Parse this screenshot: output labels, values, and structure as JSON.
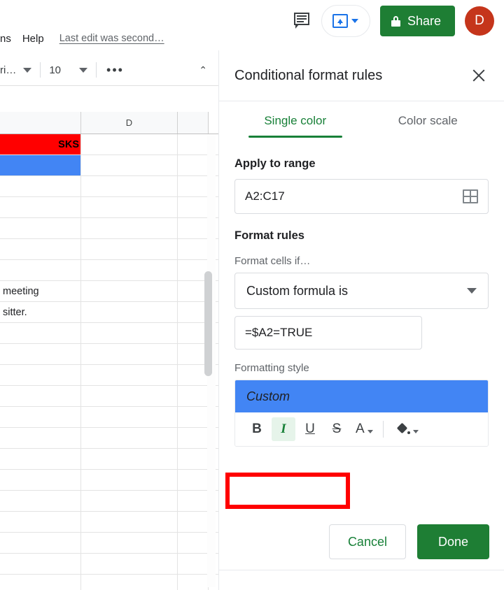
{
  "menubar": {
    "items": [
      {
        "label": "ns",
        "name": "menu-item-extensions-clipped"
      },
      {
        "label": "Help",
        "name": "menu-item-help"
      }
    ],
    "last_edit": "Last edit was second…"
  },
  "toolbar": {
    "font_name": "ri…",
    "font_size": "10",
    "more_label": "•••",
    "collapse_label": "⌃"
  },
  "header": {
    "comment_icon": "comment-icon",
    "present_icon": "present-icon",
    "share_label": "Share",
    "share_lock_icon": "lock-icon",
    "avatar_initial": "D",
    "avatar_color": "#C5351B",
    "share_color": "#1E7E34"
  },
  "sheet": {
    "columns": [
      "",
      "D",
      ""
    ],
    "rows": [
      {
        "a": "SKS",
        "fill": "#FF0000",
        "d": "",
        "e": ""
      },
      {
        "a": "",
        "fill": "#4285F4",
        "d": "",
        "e": ""
      },
      {
        "a": "",
        "fill": "",
        "d": "",
        "e": ""
      },
      {
        "a": "",
        "fill": "",
        "d": "",
        "e": ""
      },
      {
        "a": "",
        "fill": "",
        "d": "",
        "e": ""
      },
      {
        "a": "",
        "fill": "",
        "d": "",
        "e": ""
      },
      {
        "a": "",
        "fill": "",
        "d": "",
        "e": ""
      },
      {
        "a": "meeting",
        "fill": "",
        "d": "",
        "e": ""
      },
      {
        "a": "sitter.",
        "fill": "",
        "d": "",
        "e": ""
      },
      {
        "a": "",
        "fill": "",
        "d": "",
        "e": ""
      },
      {
        "a": "",
        "fill": "",
        "d": "",
        "e": ""
      },
      {
        "a": "",
        "fill": "",
        "d": "",
        "e": ""
      },
      {
        "a": "",
        "fill": "",
        "d": "",
        "e": ""
      },
      {
        "a": "",
        "fill": "",
        "d": "",
        "e": ""
      },
      {
        "a": "",
        "fill": "",
        "d": "",
        "e": ""
      },
      {
        "a": "",
        "fill": "",
        "d": "",
        "e": ""
      },
      {
        "a": "",
        "fill": "",
        "d": "",
        "e": ""
      },
      {
        "a": "",
        "fill": "",
        "d": "",
        "e": ""
      },
      {
        "a": "",
        "fill": "",
        "d": "",
        "e": ""
      },
      {
        "a": "",
        "fill": "",
        "d": "",
        "e": ""
      },
      {
        "a": "",
        "fill": "",
        "d": "",
        "e": ""
      },
      {
        "a": "",
        "fill": "",
        "d": "",
        "e": ""
      }
    ]
  },
  "panel": {
    "title": "Conditional format rules",
    "close_icon": "close-icon",
    "tabs": [
      {
        "label": "Single color",
        "active": true
      },
      {
        "label": "Color scale",
        "active": false
      }
    ],
    "apply_to_range": {
      "label": "Apply to range",
      "value": "A2:C17",
      "picker_icon": "select-range-icon"
    },
    "format_rules": {
      "label": "Format rules",
      "condition_label": "Format cells if…",
      "condition_value": "Custom formula is",
      "formula_value": "=$A2=TRUE"
    },
    "formatting_style": {
      "label": "Formatting style",
      "preview_text": "Custom",
      "preview_bg": "#4285F4",
      "buttons": [
        {
          "label": "B",
          "name": "bold-button",
          "active": false
        },
        {
          "label": "I",
          "name": "italic-button",
          "active": true
        },
        {
          "label": "U",
          "name": "underline-button",
          "active": false
        },
        {
          "label": "S",
          "name": "strikethrough-button",
          "active": false
        }
      ],
      "text_color_label": "A",
      "fill_color_icon": "fill-color-icon"
    },
    "footer": {
      "cancel_label": "Cancel",
      "done_label": "Done"
    }
  },
  "annotation": {
    "color": "#FF0000",
    "target": "text-format-buttons"
  }
}
